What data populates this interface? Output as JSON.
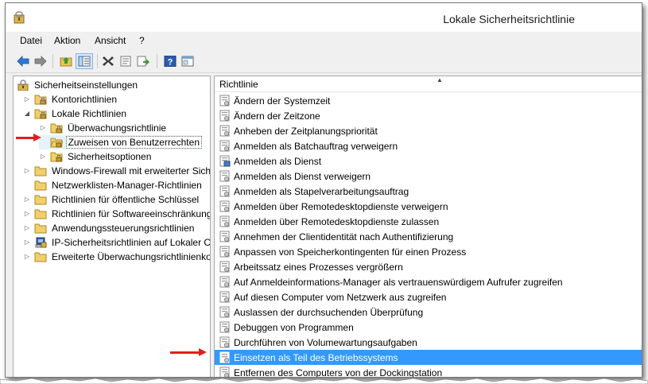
{
  "window": {
    "title": "Lokale Sicherheitsrichtlinie"
  },
  "menu": [
    "Datei",
    "Aktion",
    "Ansicht",
    "?"
  ],
  "toolbar": {
    "buttons": [
      "back-icon",
      "forward-icon",
      "up-folder-icon",
      "show-hide-tree-icon",
      "delete-icon",
      "properties-icon",
      "export-list-icon",
      "help-icon",
      "description-bar-icon"
    ]
  },
  "tree": {
    "items": [
      {
        "label": "Sicherheitseinstellungen",
        "level": 0,
        "toggle": "",
        "icon": "security-settings-icon"
      },
      {
        "label": "Kontorichtlinien",
        "level": 1,
        "toggle": "collapsed",
        "icon": "folder-lock-icon"
      },
      {
        "label": "Lokale Richtlinien",
        "level": 1,
        "toggle": "expanded",
        "icon": "folder-lock-icon"
      },
      {
        "label": "Überwachungsrichtlinie",
        "level": 2,
        "toggle": "collapsed",
        "icon": "folder-lock-icon"
      },
      {
        "label": "Zuweisen von Benutzerrechten",
        "level": 2,
        "toggle": "",
        "icon": "folder-lock-open-icon",
        "selected": true
      },
      {
        "label": "Sicherheitsoptionen",
        "level": 2,
        "toggle": "collapsed",
        "icon": "folder-lock-icon"
      },
      {
        "label": "Windows-Firewall mit erweiterter Sich",
        "level": 1,
        "toggle": "collapsed",
        "icon": "folder-icon"
      },
      {
        "label": "Netzwerklisten-Manager-Richtlinien",
        "level": 1,
        "toggle": "",
        "icon": "folder-icon"
      },
      {
        "label": "Richtlinien für öffentliche Schlüssel",
        "level": 1,
        "toggle": "collapsed",
        "icon": "folder-icon"
      },
      {
        "label": "Richtlinien für Softwareeinschränkung",
        "level": 1,
        "toggle": "collapsed",
        "icon": "folder-icon"
      },
      {
        "label": "Anwendungssteuerungsrichtlinien",
        "level": 1,
        "toggle": "collapsed",
        "icon": "folder-icon"
      },
      {
        "label": "IP-Sicherheitsrichtlinien auf Lokaler C",
        "level": 1,
        "toggle": "collapsed",
        "icon": "ipsec-computer-icon"
      },
      {
        "label": "Erweiterte Überwachungsrichtlinienko",
        "level": 1,
        "toggle": "collapsed",
        "icon": "folder-icon"
      }
    ]
  },
  "list": {
    "column": "Richtlinie",
    "rows": [
      {
        "label": "Ändern der Systemzeit",
        "icon": "policy-icon"
      },
      {
        "label": "Ändern der Zeitzone",
        "icon": "policy-icon"
      },
      {
        "label": "Anheben der Zeitplanungspriorität",
        "icon": "policy-icon"
      },
      {
        "label": "Anmelden als Batchauftrag verweigern",
        "icon": "policy-icon"
      },
      {
        "label": "Anmelden als Dienst",
        "icon": "policy-service-icon"
      },
      {
        "label": "Anmelden als Dienst verweigern",
        "icon": "policy-icon"
      },
      {
        "label": "Anmelden als Stapelverarbeitungsauftrag",
        "icon": "policy-icon"
      },
      {
        "label": "Anmelden über Remotedesktopdienste verweigern",
        "icon": "policy-icon"
      },
      {
        "label": "Anmelden über Remotedesktopdienste zulassen",
        "icon": "policy-icon"
      },
      {
        "label": "Annehmen der Clientidentität nach Authentifizierung",
        "icon": "policy-icon"
      },
      {
        "label": "Anpassen von Speicherkontingenten für einen Prozess",
        "icon": "policy-icon"
      },
      {
        "label": "Arbeitssatz eines Prozesses vergrößern",
        "icon": "policy-icon"
      },
      {
        "label": "Auf Anmeldeinformations-Manager als vertrauenswürdigem Aufrufer zugreifen",
        "icon": "policy-icon"
      },
      {
        "label": "Auf diesen Computer vom Netzwerk aus zugreifen",
        "icon": "policy-icon"
      },
      {
        "label": "Auslassen der durchsuchenden Überprüfung",
        "icon": "policy-icon"
      },
      {
        "label": "Debuggen von Programmen",
        "icon": "policy-icon"
      },
      {
        "label": "Durchführen von Volumewartungsaufgaben",
        "icon": "policy-icon"
      },
      {
        "label": "Einsetzen als Teil des Betriebssystems",
        "icon": "policy-icon",
        "selected": true
      },
      {
        "label": "Entfernen des Computers von der Dockingstation",
        "icon": "policy-icon"
      }
    ]
  },
  "colors": {
    "selection": "#3399ff",
    "annotation_arrow": "#e0201b",
    "folder": "#e8c15a"
  }
}
